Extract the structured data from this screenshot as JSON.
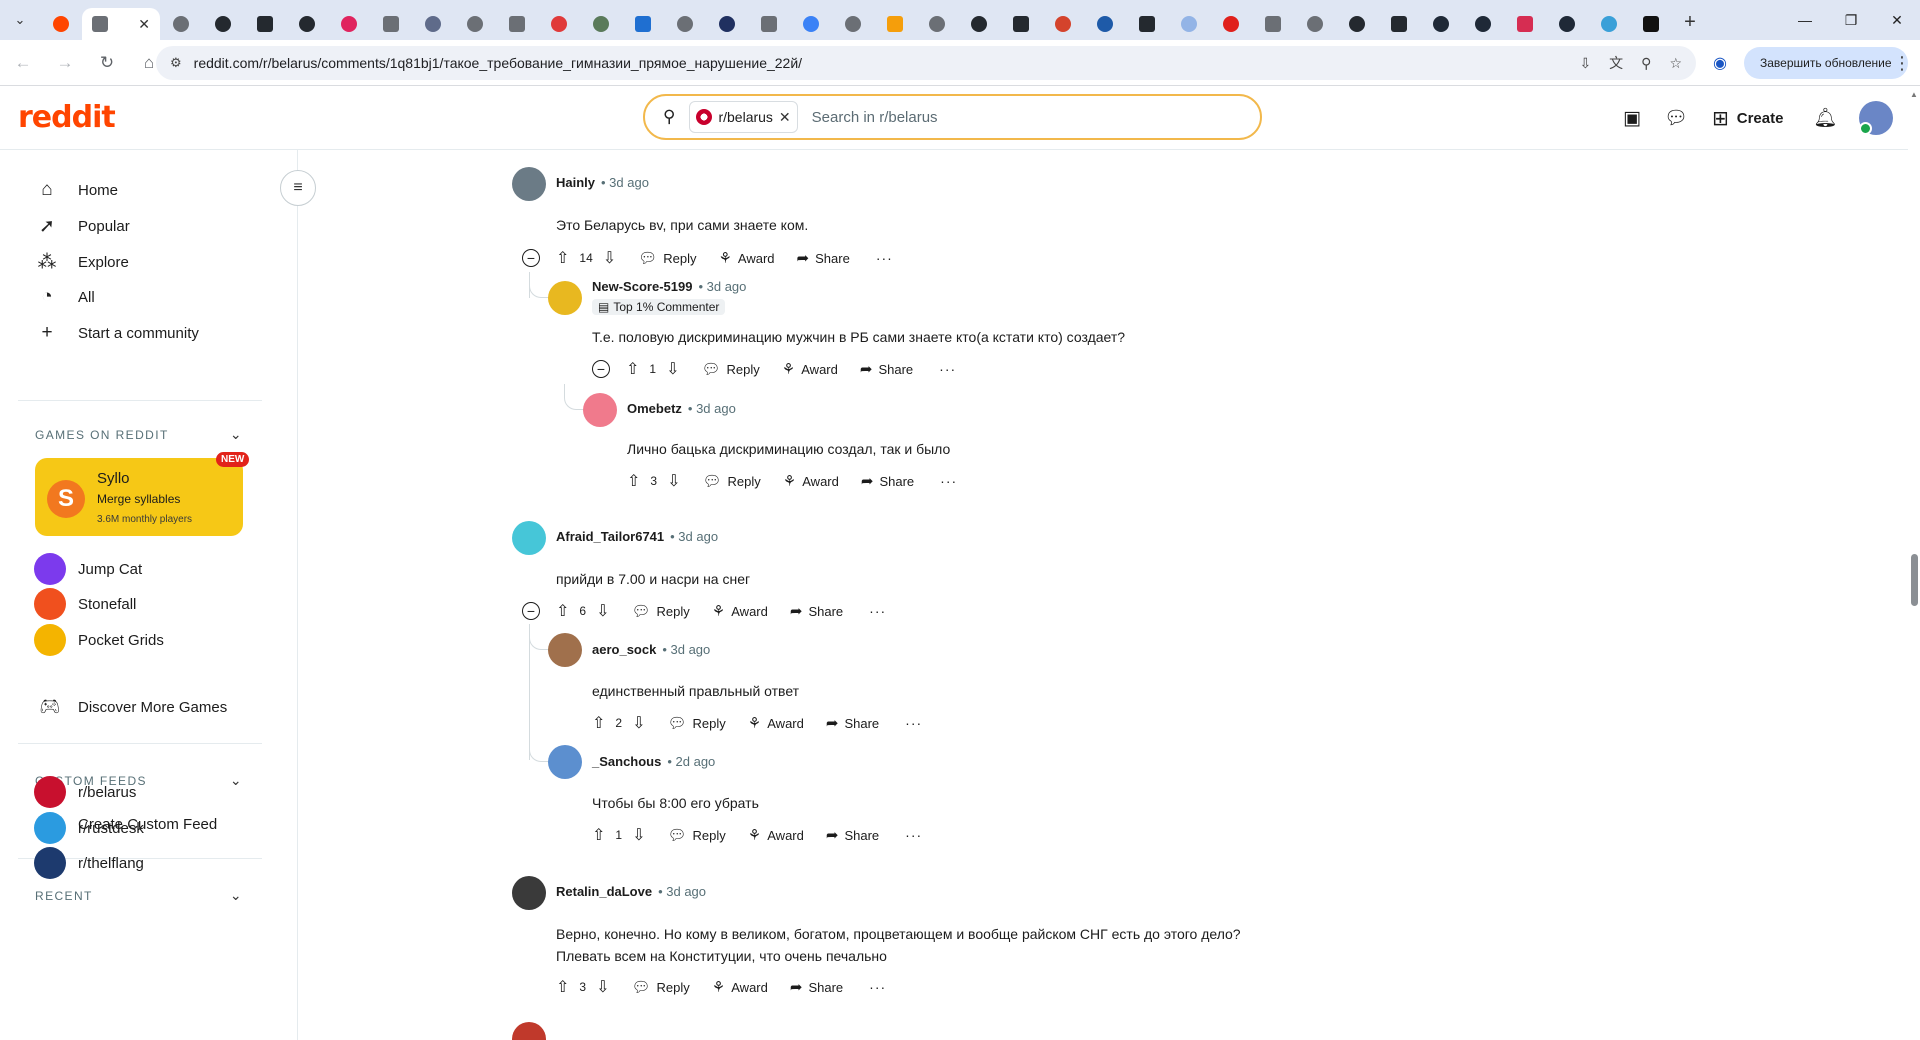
{
  "browser": {
    "tab_close": "✕",
    "new_tab": "+",
    "window_controls": [
      "—",
      "❐",
      "✕"
    ],
    "url": "reddit.com/r/belarus/comments/1q81bj1/такое_требование_гимназии_прямое_нарушение_22й/",
    "update_label": "Завершить обновление",
    "favicon_colors": [
      "#ff4500",
      "#6b6f75",
      "#6b6f75",
      "#24292f",
      "#24292f",
      "#24292f",
      "#e0245e",
      "#6b6f75",
      "#5f6b8a",
      "#6b6f75",
      "#6b6f75",
      "#e03a3a",
      "#5a7a5a",
      "#1f6fd1",
      "#6b6f75",
      "#203060",
      "#6b6f75",
      "#3b82f6",
      "#6b6f75",
      "#f59e0b",
      "#6b6f75",
      "#24292f",
      "#24292f",
      "#d4432c",
      "#1e5aa8",
      "#24292f",
      "#93b4e6",
      "#e0201b",
      "#6b6f75",
      "#6b6f75",
      "#24292f",
      "#24292f",
      "#1f2937",
      "#1f2937",
      "#d62d52",
      "#1f2937",
      "#3aa0d8",
      "#111111"
    ]
  },
  "header": {
    "logo": "reddit",
    "search_chip": "r/belarus",
    "search_placeholder": "Search in r/belarus",
    "create_label": "Create"
  },
  "sidebar": {
    "nav": [
      {
        "label": "Home",
        "icon": "home-icon",
        "glyph": "⌂"
      },
      {
        "label": "Popular",
        "icon": "popular-icon",
        "glyph": "➚"
      },
      {
        "label": "Explore",
        "icon": "explore-icon",
        "glyph": "⁂"
      },
      {
        "label": "All",
        "icon": "all-icon",
        "glyph": "◔"
      },
      {
        "label": "Start a community",
        "icon": "plus-icon",
        "glyph": "+"
      }
    ],
    "games_heading": "GAMES ON REDDIT",
    "featured_game": {
      "name": "Syllo",
      "tagline": "Merge syllables",
      "players": "3.6M monthly players",
      "badge": "NEW",
      "logo_letter": "S"
    },
    "games": [
      {
        "label": "Jump Cat",
        "color": "#7c3aed"
      },
      {
        "label": "Stonefall",
        "color": "#f0501e"
      },
      {
        "label": "Pocket Grids",
        "color": "#f4b400"
      }
    ],
    "discover_label": "Discover More Games",
    "custom_feeds_heading": "CUSTOM FEEDS",
    "create_feed_label": "Create Custom Feed",
    "recent_heading": "RECENT",
    "recent": [
      {
        "label": "r/belarus",
        "color": "#c8102e"
      },
      {
        "label": "r/rustdesk",
        "color": "#2b9be0"
      },
      {
        "label": "r/thelflang",
        "color": "#1d3a6e"
      }
    ]
  },
  "actions": {
    "reply": "Reply",
    "award": "Award",
    "share": "Share",
    "more": "···"
  },
  "comments": [
    {
      "author": "Hainly",
      "time": "• 3d ago",
      "body": "Это Беларусь вv, при сами знаете ком.",
      "score": "14",
      "avatar_color": "#6b7b86"
    },
    {
      "author": "New-Score-5199",
      "time": "• 3d ago",
      "badge": "Top 1% Commenter",
      "body": "Т.е. половую дискриминацию мужчин в РБ сами знаете кто(а кстати кто) создает?",
      "score": "1",
      "avatar_color": "#e8b820"
    },
    {
      "author": "Omebetz",
      "time": "• 3d ago",
      "body": "Лично бацька дискриминацию создал, так и было",
      "score": "3",
      "avatar_color": "#f07a8c"
    },
    {
      "author": "Afraid_Tailor6741",
      "time": "• 3d ago",
      "body": "прийди в 7.00 и насри на снег",
      "score": "6",
      "avatar_color": "#46c6d8"
    },
    {
      "author": "aero_sock",
      "time": "• 3d ago",
      "body": "единственный правльный ответ",
      "score": "2",
      "avatar_color": "#a0704c"
    },
    {
      "author": "_Sanchous",
      "time": "• 2d ago",
      "body": "Чтобы бы 8:00 его убрать",
      "score": "1",
      "avatar_color": "#5c8fcf"
    },
    {
      "author": "Retalin_daLove",
      "time": "• 3d ago",
      "body": "Верно, конечно. Но кому в великом, богатом, процветающем и вообще райском СНГ есть до этого дело?",
      "body2": "Плевать всем на Конституции, что очень печально",
      "score": "3",
      "avatar_color": "#3a3a3a"
    }
  ]
}
